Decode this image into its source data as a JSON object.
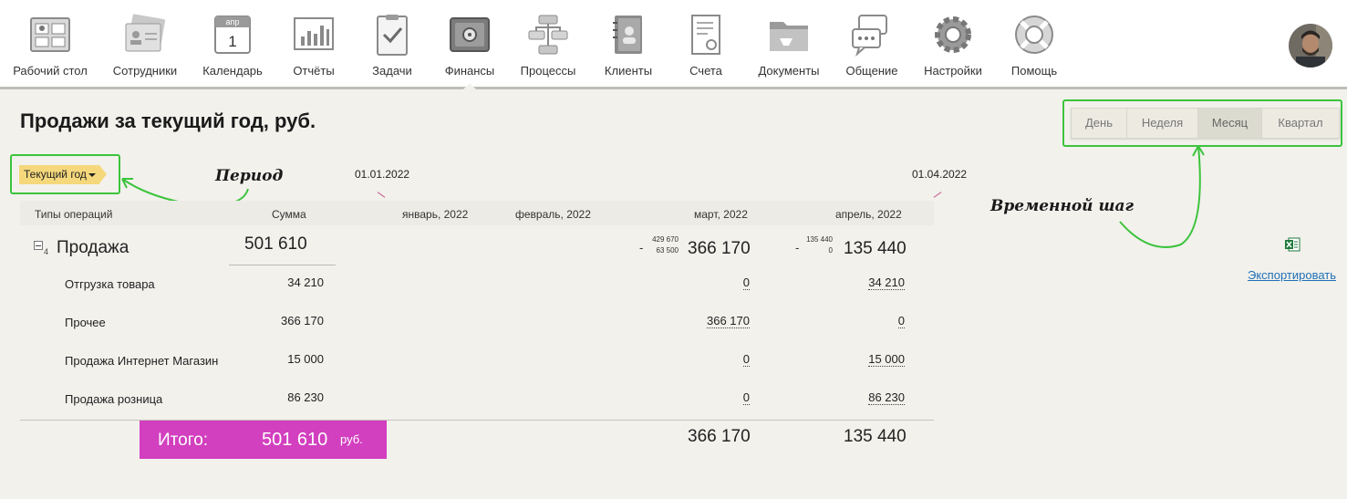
{
  "nav": {
    "items": [
      {
        "label": "Рабочий стол",
        "icon": "desktop-icon"
      },
      {
        "label": "Сотрудники",
        "icon": "employees-icon"
      },
      {
        "label": "Календарь",
        "icon": "calendar-icon",
        "cal_month": "апр",
        "cal_day": "1"
      },
      {
        "label": "Отчёты",
        "icon": "reports-icon"
      },
      {
        "label": "Задачи",
        "icon": "tasks-icon"
      },
      {
        "label": "Финансы",
        "icon": "safe-icon"
      },
      {
        "label": "Процессы",
        "icon": "processes-icon"
      },
      {
        "label": "Клиенты",
        "icon": "clients-icon"
      },
      {
        "label": "Счета",
        "icon": "invoice-icon"
      },
      {
        "label": "Документы",
        "icon": "folder-icon"
      },
      {
        "label": "Общение",
        "icon": "chat-icon"
      },
      {
        "label": "Настройки",
        "icon": "gear-icon"
      },
      {
        "label": "Помощь",
        "icon": "lifebuoy-icon"
      }
    ],
    "active": "Финансы"
  },
  "page": {
    "title": "Продажи за текущий год, руб."
  },
  "steps": {
    "items": [
      "День",
      "Неделя",
      "Месяц",
      "Квартал"
    ],
    "selected": "Месяц"
  },
  "period": {
    "label": "Текущий год"
  },
  "annotations": {
    "period": "Период",
    "step": "Временной шаг"
  },
  "dates": {
    "start": "01.01.2022",
    "end": "01.04.2022"
  },
  "table": {
    "headers": {
      "types": "Типы операций",
      "sum": "Сумма",
      "months": [
        "январь, 2022",
        "февраль, 2022",
        "март, 2022",
        "апрель, 2022"
      ]
    },
    "group": {
      "collapse_count": "4",
      "name": "Продажа",
      "sum": "501 610",
      "march": {
        "total": "366 170",
        "top": "429 670",
        "bottom": "63 500",
        "sign": "-"
      },
      "april": {
        "total": "135 440",
        "top": "135 440",
        "bottom": "0",
        "sign": "-"
      }
    },
    "rows": [
      {
        "name": "Отгрузка товара",
        "sum": "34 210",
        "march": "0",
        "april": "34 210"
      },
      {
        "name": "Прочее",
        "sum": "366 170",
        "march": "366 170",
        "april": "0"
      },
      {
        "name": "Продажа Интернет Магазин",
        "sum": "15 000",
        "march": "0",
        "april": "15 000"
      },
      {
        "name": "Продажа розница",
        "sum": "86 230",
        "march": "0",
        "april": "86 230"
      }
    ],
    "totals": {
      "label": "Итого:",
      "sum": "501 610",
      "unit": "руб.",
      "march": "366 170",
      "april": "135 440"
    }
  },
  "export": {
    "label": "Экспортировать",
    "icon": "excel-icon"
  },
  "colors": {
    "accent_green": "#3cc43c",
    "total_bg": "#d23fbf",
    "period_tag": "#f5d87c",
    "link": "#1f6fb5"
  }
}
